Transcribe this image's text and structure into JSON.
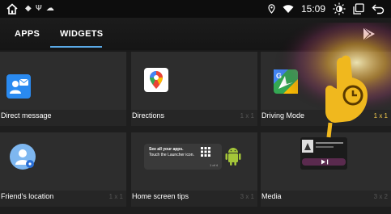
{
  "status_bar": {
    "time": "15:09",
    "notification_icons": "◆ Ψ ☁"
  },
  "tabs": [
    {
      "label": "APPS",
      "selected": false
    },
    {
      "label": "WIDGETS",
      "selected": true
    }
  ],
  "colors": {
    "accent": "#5aa9e6",
    "size_highlight": "#f2c94c",
    "hand": "#f0b81e"
  },
  "widgets": [
    {
      "name": "Direct message",
      "size": ""
    },
    {
      "name": "Directions",
      "size": "1 x 1"
    },
    {
      "name": "Driving Mode",
      "size": "1 x 1"
    },
    {
      "name": "Friend's location",
      "size": "1 x 1"
    },
    {
      "name": "Home screen tips",
      "size": "3 x 1"
    },
    {
      "name": "Media",
      "size": "3 x 2"
    }
  ],
  "tip_card": {
    "line1": "See all your apps.",
    "line2": "Touch the Launcher icon.",
    "page": "1 of 4"
  },
  "icons": {
    "home": "home-icon",
    "location": "location-pin-icon",
    "wifi": "wifi-icon",
    "brightness": "brightness-icon",
    "recents": "recents-icon",
    "back": "back-icon",
    "play_store": "play-store-icon"
  }
}
